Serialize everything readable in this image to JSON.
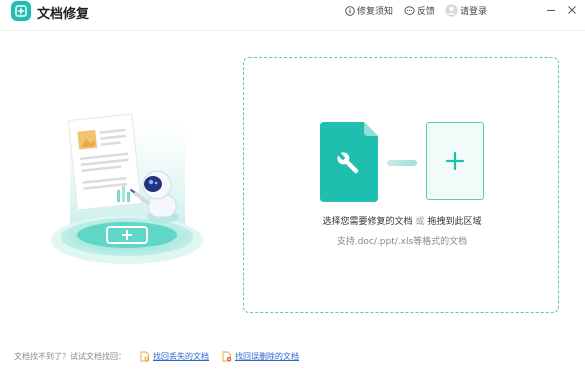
{
  "app": {
    "title": "文档修复",
    "logo_icon": "document-repair-logo-icon",
    "brand_color": "#1fbfb0"
  },
  "header": {
    "help_label": "修复须知",
    "help_icon": "info-circle-icon",
    "feedback_label": "反馈",
    "feedback_icon": "chat-bubble-icon",
    "login_label": "请登录",
    "login_icon": "avatar-icon"
  },
  "window_controls": {
    "minimize_icon": "minimize-icon",
    "close_icon": "close-icon"
  },
  "dropzone": {
    "main_text": "选择您需要修复的文档",
    "or_text": "或",
    "drag_text": "拖拽到此区域",
    "sub_text": "支持.doc/.ppt/.xls等格式的文档",
    "doc_icon": "wrench-document-icon",
    "add_icon": "plus-icon",
    "accent_color": "#1fbfb0"
  },
  "footer": {
    "label": "文档找不到了？试试文档找回：",
    "link1": "找回丢失的文档",
    "link2": "找回误删除的文档",
    "link_color": "#2f66c9"
  }
}
